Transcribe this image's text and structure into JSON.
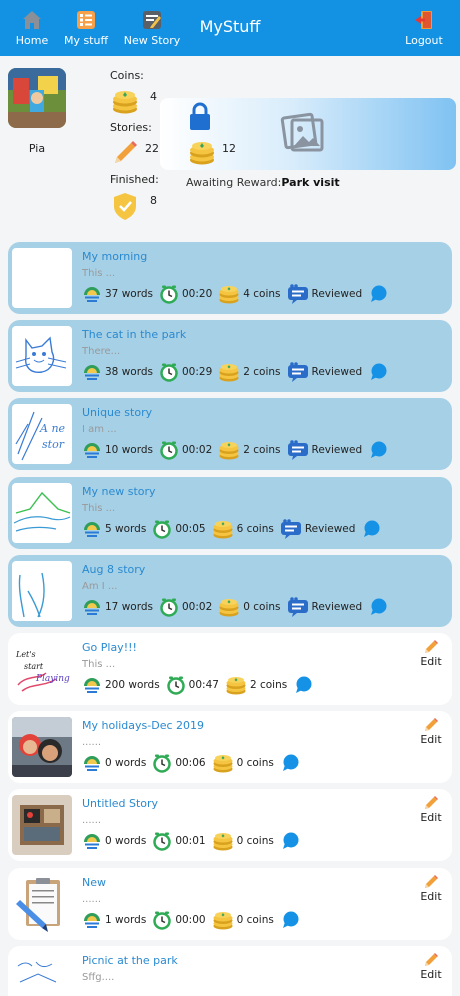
{
  "nav": {
    "home": "Home",
    "my_stuff": "My stuff",
    "new_story": "New Story",
    "title": "MyStuff",
    "logout": "Logout"
  },
  "profile": {
    "name": "Pia",
    "coins_label": "Coins:",
    "coins": "4",
    "stories_label": "Stories:",
    "stories": "22",
    "finished_label": "Finished:",
    "finished": "8"
  },
  "reward": {
    "coins": "12",
    "label": "Awaiting Reward:",
    "name": "Park visit"
  },
  "stories": [
    {
      "title": "My morning",
      "excerpt": "This ...",
      "words": "37 words",
      "time": "00:20",
      "coins": "4 coins",
      "status": "Reviewed"
    },
    {
      "title": "The cat in the park",
      "excerpt": "There...",
      "words": "38 words",
      "time": "00:29",
      "coins": "2 coins",
      "status": "Reviewed"
    },
    {
      "title": "Unique story",
      "excerpt": "I am ...",
      "words": "10 words",
      "time": "00:02",
      "coins": "2 coins",
      "status": "Reviewed",
      "thumb_text": "A new story"
    },
    {
      "title": "My new story",
      "excerpt": "This  ...",
      "words": "5 words",
      "time": "00:05",
      "coins": "6 coins",
      "status": "Reviewed"
    },
    {
      "title": "Aug 8 story",
      "excerpt": "Am I ...",
      "words": "17 words",
      "time": "00:02",
      "coins": "0 coins",
      "status": "Reviewed"
    },
    {
      "title": "Go Play!!!",
      "excerpt": "This ...",
      "words": "200 words",
      "time": "00:47",
      "coins": "2 coins",
      "edit": "Edit",
      "thumb_text": "Let's Start Playing"
    },
    {
      "title": "My holidays-Dec 2019",
      "excerpt": "......",
      "words": "0 words",
      "time": "00:06",
      "coins": "0 coins",
      "edit": "Edit"
    },
    {
      "title": "Untitled Story",
      "excerpt": "......",
      "words": "0 words",
      "time": "00:01",
      "coins": "0 coins",
      "edit": "Edit"
    },
    {
      "title": "New",
      "excerpt": "......",
      "words": "1 words",
      "time": "00:00",
      "coins": "0 coins",
      "edit": "Edit"
    },
    {
      "title": "Picnic at the park",
      "excerpt": "Sffg....",
      "edit": "Edit"
    }
  ],
  "colors": {
    "topbar": "#1392e4",
    "reviewed_card": "#a6d0e6",
    "draft_card": "#ffffff",
    "title_text": "#2a8ad0"
  }
}
